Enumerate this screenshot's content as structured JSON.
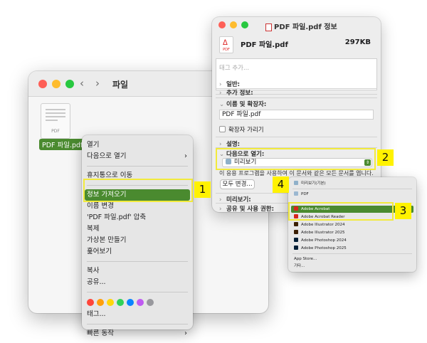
{
  "finder": {
    "title": "파일",
    "back_icon": "‹",
    "forward_icon": "›",
    "file": {
      "label": "PDF 파일.pdf",
      "ext": "PDF"
    }
  },
  "context_menu": {
    "items": [
      {
        "label": "열기"
      },
      {
        "label": "다음으로 열기",
        "chevron": "›"
      },
      {
        "label": "휴지통으로 이동"
      },
      {
        "label": "정보 가져오기"
      },
      {
        "label": "이름 변경"
      },
      {
        "label": "'PDF 파일.pdf' 압축"
      },
      {
        "label": "복제"
      },
      {
        "label": "가상본 만들기"
      },
      {
        "label": "훑어보기"
      },
      {
        "label": "복사"
      },
      {
        "label": "공유..."
      },
      {
        "label": "태그..."
      },
      {
        "label": "빠른 동작",
        "chevron": "›"
      }
    ],
    "tag_colors": [
      "#ff453a",
      "#ff9f0a",
      "#ffd60a",
      "#30d158",
      "#0a84ff",
      "#bf5af2",
      "#98989d"
    ]
  },
  "info_window": {
    "title": "PDF 파일.pdf 정보",
    "file_name": "PDF 파일.pdf",
    "file_size": "297KB",
    "icon_label": "PDF",
    "tags_placeholder": "태그 추가...",
    "sections": {
      "general": "일반:",
      "more_info": "추가 정보:",
      "name_ext": "이름 및 확장자:",
      "comments": "설명:",
      "open_with": "다음으로 열기:",
      "preview": "미리보기:",
      "sharing": "공유 및 사용 권한:"
    },
    "name_value": "PDF 파일.pdf",
    "hide_extension": "확장자 가리기",
    "open_with_app": "미리보기",
    "description": "이 응용 프로그램을 사용하여 이 문서와 같은 모든 문서를 엽니다.",
    "change_all": "모두 변경..."
  },
  "open_with_menu": {
    "items": [
      {
        "label": "미리보기(기본)",
        "color": "#8fb0c9"
      },
      {
        "label": "PDF",
        "color": "#9bb7d0"
      },
      {
        "label": "Adobe Acrobat",
        "color": "#d7261e"
      },
      {
        "label": "Adobe Acrobat Reader",
        "color": "#d7261e"
      },
      {
        "label": "Adobe Illustrator 2024",
        "color": "#3a1f04"
      },
      {
        "label": "Adobe Illustrator 2025",
        "color": "#3a1f04"
      },
      {
        "label": "Adobe Photoshop 2024",
        "color": "#001e36"
      },
      {
        "label": "Adobe Photoshop 2025",
        "color": "#001e36"
      },
      {
        "label": "App Store..."
      },
      {
        "label": "기타..."
      }
    ]
  },
  "annotations": {
    "step1": "1",
    "step2": "2",
    "step3": "3",
    "step4": "4",
    "color": "#fff200"
  }
}
